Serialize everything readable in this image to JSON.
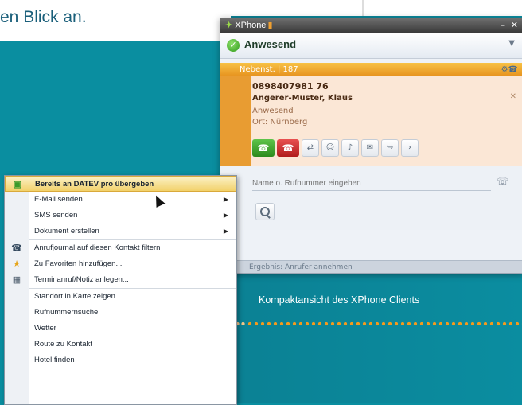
{
  "headline": "en Blick an.",
  "caption": "Kompaktansicht des XPhone Clients",
  "xphone": {
    "app_title": "XPhone",
    "presence": "Anwesend",
    "line_label": "Nebenst. | 187",
    "contact": {
      "number": "0898407981 76",
      "name": "Angerer-Muster, Klaus",
      "status": "Anwesend",
      "location": "Ort:  Nürnberg"
    },
    "search_placeholder": "Name o. Rufnummer eingeben",
    "statusbar": "Ergebnis: Anrufer annehmen"
  },
  "context_menu": {
    "items": [
      {
        "label": "Bereits an DATEV pro übergeben",
        "icon": "datev-icon",
        "highlight": true
      },
      {
        "label": "E-Mail senden",
        "submenu": true
      },
      {
        "label": "SMS senden",
        "submenu": true
      },
      {
        "label": "Dokument erstellen",
        "submenu": true
      },
      {
        "label": "Anrufjournal auf diesen Kontakt filtern",
        "icon": "phone-icon"
      },
      {
        "label": "Zu Favoriten hinzufügen...",
        "icon": "star-icon"
      },
      {
        "label": "Terminanruf/Notiz anlegen...",
        "icon": "calendar-icon"
      },
      {
        "label": "Standort in Karte zeigen"
      },
      {
        "label": "Rufnummernsuche"
      },
      {
        "label": "Wetter"
      },
      {
        "label": "Route zu Kontakt"
      },
      {
        "label": "Hotel finden"
      }
    ]
  },
  "colors": {
    "background": "#0a8ea0",
    "headline": "#1a5f7a",
    "dotline": "#f39a1e"
  }
}
